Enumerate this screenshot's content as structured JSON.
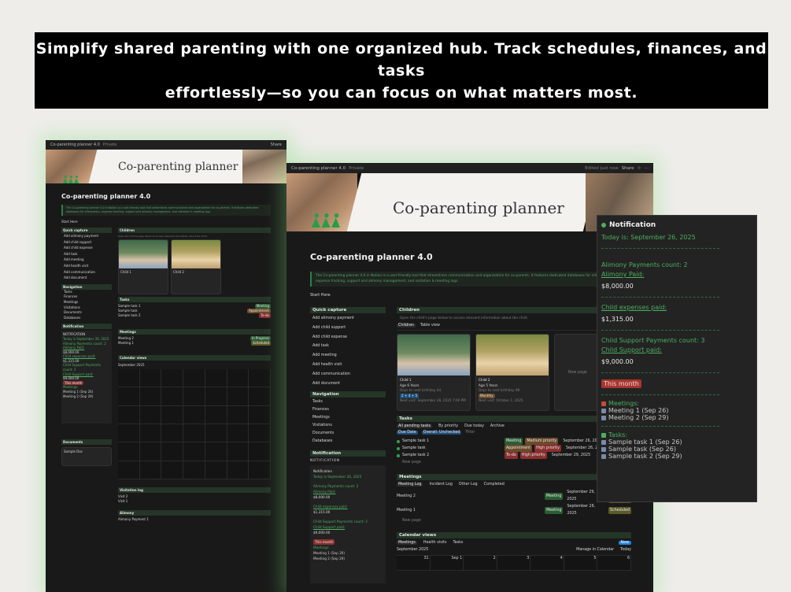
{
  "banner": {
    "line1": "Simplify shared parenting with one organized hub. Track schedules, finances, and tasks",
    "line2": "effortlessly—so you can focus on what matters most."
  },
  "breadcrumb": "Co-parenting planner 4.0",
  "privacy": "Private",
  "share": "Share",
  "edited": "Edited just now",
  "cover_title": "Co-parenting planner",
  "page_title": "Co-parenting planner 4.0",
  "callout": "The Co-parenting planner 4.0 in Notion is a user-friendly tool that streamlines communication and organization for co-parents. It features dedicated databases for information, expense tracking, support and alimony management, and visitation & meeting logs.",
  "start_here": "Start Here",
  "quick_capture": {
    "title": "Quick capture",
    "items": [
      "Add alimony payment",
      "Add child support",
      "Add child expense",
      "Add task",
      "Add meeting",
      "Add health visit",
      "Add communication",
      "Add document"
    ]
  },
  "navigation": {
    "title": "Navigation",
    "items": [
      "Tasks",
      "Finances",
      "Meetings",
      "Visitations",
      "Documents",
      "Databases"
    ]
  },
  "notification_section": {
    "title": "Notification",
    "label": "NOTIFICATION",
    "today": "Today is September 26, 2025",
    "alimony_count": "Alimony Payments count: 2",
    "alimony_paid": "Alimony Paid:",
    "alimony_value": "$8,000.00",
    "expenses_paid": "Child expenses paid:",
    "expenses_value": "$1,315.00",
    "support_count": "Child Support Payments count: 3",
    "support_paid": "Child Support paid:",
    "support_value": "$9,000.00",
    "this_month": "This month",
    "meetings": "Meetings:",
    "meeting1": "Meeting 1 (Sep 26)",
    "meeting2": "Meeting 2 (Sep 29)"
  },
  "children": {
    "title": "Children",
    "hint": "Open the child's page below to access relevant information about the child.",
    "tabs": [
      "Children",
      "Table view"
    ],
    "new": "New",
    "new_page": "New page",
    "kids": [
      {
        "name": "Child 1",
        "age": "Age 6 Years",
        "bday": "Days to next birthday 44",
        "chip": "2 + 4 + 5",
        "visit": "Next visit: September 28, 2025 7:00 PM"
      },
      {
        "name": "Child 2",
        "age": "Age 5 Years",
        "bday": "Days to next birthday 98",
        "chip": "Monthly",
        "visit": "Next visit: October 1, 2025"
      }
    ]
  },
  "tasks": {
    "title": "Tasks",
    "tabs": [
      "All pending tasks",
      "By priority",
      "Due today",
      "Archive"
    ],
    "filters": [
      "Due Date",
      "Overall: Unchecked",
      "Filter"
    ],
    "rows": [
      {
        "name": "Sample task 1",
        "type": "Meeting",
        "priority": "Medium priority",
        "date": "September 26, 2025"
      },
      {
        "name": "Sample task",
        "type": "Appointment",
        "priority": "High priority",
        "date": "September 26, 2025"
      },
      {
        "name": "Sample task 2",
        "type": "To-do",
        "priority": "High priority",
        "date": "September 29, 2025"
      }
    ],
    "new_page": "New page"
  },
  "meetings": {
    "title": "Meetings",
    "tabs": [
      "Meeting Log",
      "Incident Log",
      "Other Log",
      "Completed"
    ],
    "rows": [
      {
        "name": "Meeting 2",
        "type": "Meeting",
        "date": "September 29, 2025",
        "status": "In Progress"
      },
      {
        "name": "Meeting 1",
        "type": "Meeting",
        "date": "September 26, 2025",
        "status": "Scheduled"
      }
    ],
    "new_page": "New page"
  },
  "calendar": {
    "title": "Calendar views",
    "tabs": [
      "Meetings",
      "Health visits",
      "Tasks"
    ],
    "month": "September 2025",
    "manage": "Manage in Calendar",
    "today": "Today",
    "days": [
      "31",
      "Sep 1",
      "2",
      "3",
      "4",
      "5",
      "6"
    ]
  },
  "left": {
    "visitation_log": "Visitation log",
    "alimony": "Alimony",
    "documents": "Documents",
    "visits": [
      "Visit 2",
      "Visit 1"
    ],
    "doc": "Sample Doc",
    "alimony_row": "Alimony Payment 1"
  },
  "panel": {
    "title": "Notification",
    "today": "Today is: September 26, 2025",
    "alimony_count": "Alimony Payments count: 2",
    "alimony_paid": "Alimony Paid:",
    "alimony_value": "$8,000.00",
    "expenses_paid": "Child expenses paid:",
    "expenses_value": "$1,315.00",
    "support_count": "Child Support Payments count: 3",
    "support_paid": "Child Support paid:",
    "support_value": "$9,000.00",
    "this_month": "This month",
    "meetings": "Meetings:",
    "meeting_items": [
      "Meeting 1 (Sep 26)",
      "Meeting 2 (Sep 29)"
    ],
    "tasks": "Tasks:",
    "task_items": [
      "Sample task 1 (Sep 26)",
      "Sample task (Sep 26)",
      "Sample task 2 (Sep 29)"
    ]
  }
}
